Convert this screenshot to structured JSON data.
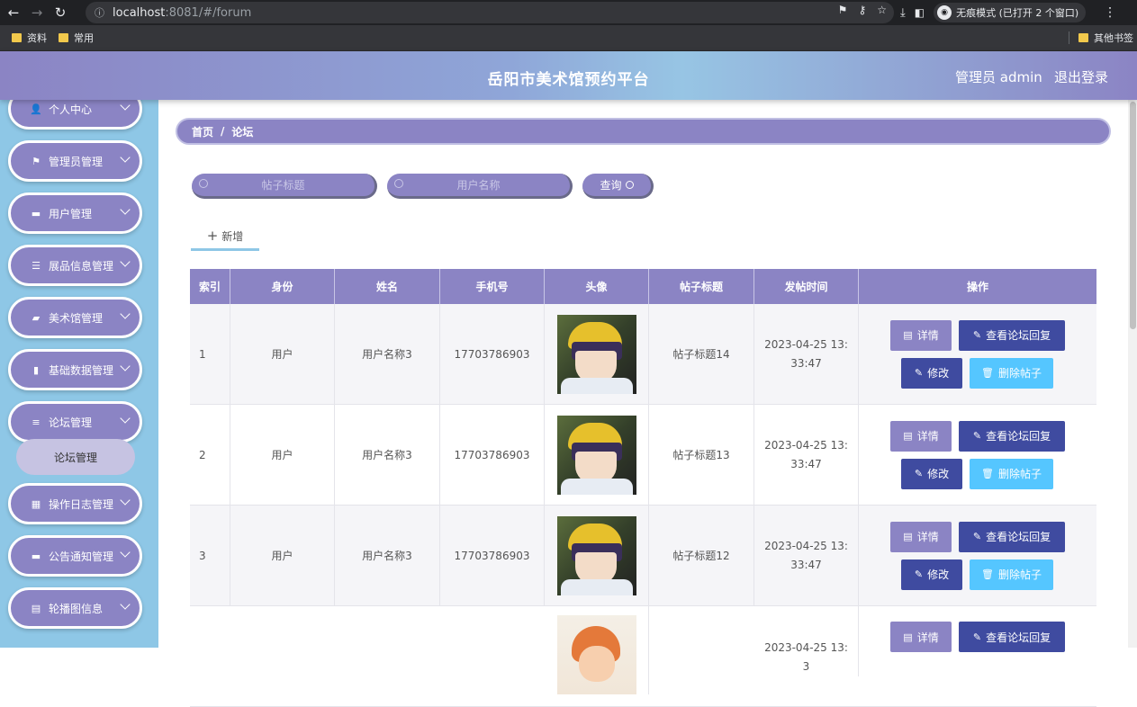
{
  "browser": {
    "url_host": "localhost",
    "url_rest": ":8081/#/forum",
    "incognito_label": "无痕模式 (已打开 2 个窗口)",
    "bookmarks": [
      "资料",
      "常用"
    ],
    "other_bookmarks": "其他书签"
  },
  "header": {
    "title": "岳阳市美术馆预约平台",
    "user": "管理员 admin",
    "logout": "退出登录"
  },
  "sidebar": {
    "items": [
      {
        "label": "个人中心",
        "icon": "user-icon"
      },
      {
        "label": "管理员管理",
        "icon": "flag-icon"
      },
      {
        "label": "用户管理",
        "icon": "card-icon"
      },
      {
        "label": "展品信息管理",
        "icon": "list-icon"
      },
      {
        "label": "美术馆管理",
        "icon": "thumb-icon"
      },
      {
        "label": "基础数据管理",
        "icon": "bar-chart-icon"
      },
      {
        "label": "论坛管理",
        "icon": "sliders-icon"
      },
      {
        "label": "操作日志管理",
        "icon": "grid-icon"
      },
      {
        "label": "公告通知管理",
        "icon": "briefcase-icon"
      },
      {
        "label": "轮播图信息",
        "icon": "clipboard-icon"
      }
    ],
    "submenu": "论坛管理"
  },
  "breadcrumb": {
    "home": "首页",
    "sep": "/",
    "current": "论坛"
  },
  "search": {
    "title_placeholder": "帖子标题",
    "user_placeholder": "用户名称",
    "query_label": "查询"
  },
  "add_label": "新增",
  "table": {
    "headers": [
      "索引",
      "身份",
      "姓名",
      "手机号",
      "头像",
      "帖子标题",
      "发帖时间",
      "操作"
    ],
    "rows": [
      {
        "index": "1",
        "role": "用户",
        "name": "用户名称3",
        "phone": "17703786903",
        "title": "帖子标题14",
        "time": "2023-04-25 13:33:47"
      },
      {
        "index": "2",
        "role": "用户",
        "name": "用户名称3",
        "phone": "17703786903",
        "title": "帖子标题13",
        "time": "2023-04-25 13:33:47"
      },
      {
        "index": "3",
        "role": "用户",
        "name": "用户名称3",
        "phone": "17703786903",
        "title": "帖子标题12",
        "time": "2023-04-25 13:33:47"
      },
      {
        "index": "",
        "role": "",
        "name": "",
        "phone": "",
        "title": "",
        "time": "2023-04-25 13:3"
      }
    ],
    "actions": {
      "detail": "详情",
      "replies": "查看论坛回复",
      "edit": "修改",
      "delete": "删除帖子"
    }
  },
  "colors": {
    "primary": "#8b84c4",
    "sidebar_bg": "#8ec7e6",
    "dark_btn": "#3f4ba0",
    "light_btn": "#55c6ff"
  }
}
